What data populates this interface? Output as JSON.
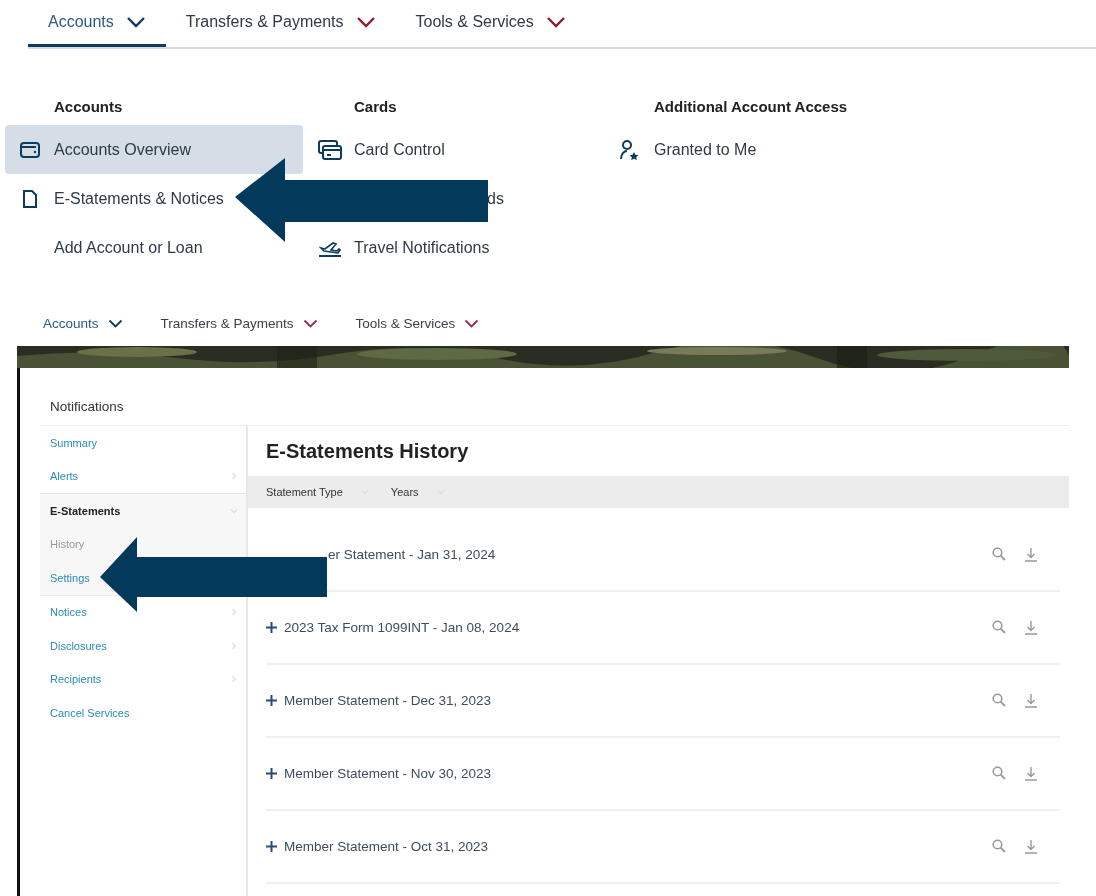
{
  "menu_view": {
    "nav_tabs": [
      {
        "label": "Accounts",
        "selected": true
      },
      {
        "label": "Transfers & Payments",
        "selected": false
      },
      {
        "label": "Tools & Services",
        "selected": false
      }
    ],
    "menu_columns": [
      {
        "heading": "Accounts",
        "items": [
          {
            "label": "Accounts Overview",
            "kind": "wallet",
            "selected": true
          },
          {
            "label": "E-Statements & Notices",
            "kind": "document",
            "selected": false
          },
          {
            "label": "Add Account or Loan",
            "kind": "plain",
            "selected": false
          }
        ]
      },
      {
        "heading": "Cards",
        "items": [
          {
            "label": "Card Control",
            "kind": "cards",
            "selected": false
          },
          {
            "label": "ds",
            "kind": "partial",
            "selected": false
          },
          {
            "label": "Travel Notifications",
            "kind": "plane",
            "selected": false
          }
        ]
      },
      {
        "heading": "Additional Account Access",
        "items": [
          {
            "label": "Granted to Me",
            "kind": "person",
            "selected": false
          }
        ]
      }
    ]
  },
  "statements_view": {
    "nav_tabs": [
      {
        "label": "Accounts",
        "selected": true
      },
      {
        "label": "Transfers & Payments",
        "selected": false
      },
      {
        "label": "Tools & Services",
        "selected": false
      }
    ],
    "sidebar": {
      "title": "Notifications",
      "items": [
        {
          "label": "Summary",
          "expandable": false,
          "selected": false
        },
        {
          "label": "Alerts",
          "expandable": true,
          "selected": false
        },
        {
          "label": "E-Statements",
          "expandable": true,
          "selected": false,
          "expanded": true,
          "children": [
            {
              "label": "History",
              "selected": true
            },
            {
              "label": "Settings",
              "selected": false
            }
          ]
        },
        {
          "label": "Notices",
          "expandable": true,
          "selected": false
        },
        {
          "label": "Disclosures",
          "expandable": true,
          "selected": false
        },
        {
          "label": "Recipients",
          "expandable": true,
          "selected": false
        },
        {
          "label": "Cancel Services",
          "expandable": false,
          "selected": false
        }
      ]
    },
    "main": {
      "title": "E-Statements History",
      "filters": [
        {
          "label": "Statement Type"
        },
        {
          "label": "Years"
        }
      ],
      "rows": [
        {
          "label": "er Statement - Jan 31, 2024",
          "kind": "partial"
        },
        {
          "label": "2023 Tax Form 1099INT - Jan 08, 2024",
          "kind": "full"
        },
        {
          "label": "Member Statement - Dec 31, 2023",
          "kind": "full"
        },
        {
          "label": "Member Statement - Nov 30, 2023",
          "kind": "full"
        },
        {
          "label": "Member Statement - Oct 31, 2023",
          "kind": "full"
        }
      ]
    }
  }
}
